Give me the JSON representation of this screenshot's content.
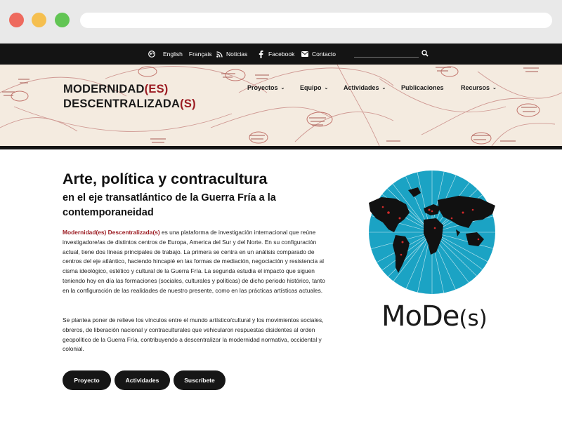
{
  "topbar": {
    "english": "English",
    "francais": "Français",
    "noticias": "Noticias",
    "facebook": "Facebook",
    "contacto": "Contacto",
    "icons": [
      "globe-icon",
      "rss-icon",
      "facebook-icon",
      "mail-icon",
      "search-icon"
    ]
  },
  "logo": {
    "line1_a": "MODERNIDAD",
    "line1_b": "(ES)",
    "line2_a": "DESCENTRALIZADA",
    "line2_b": "(S)",
    "accent_color": "#9b1b22"
  },
  "nav": {
    "items": [
      {
        "label": "Proyectos",
        "chev": "⌄"
      },
      {
        "label": "Equipo",
        "chev": "⌄"
      },
      {
        "label": "Actividades",
        "chev": "⌄"
      },
      {
        "label": "Publicaciones",
        "chev": ""
      },
      {
        "label": "Recursos",
        "chev": "⌄"
      }
    ]
  },
  "main": {
    "title": "Arte, política y contracultura",
    "subtitle": "en el eje transatlántico de la Guerra Fría a la contemporaneidad",
    "p1_lead": "Modernidad(es) Descentralizada(s)",
    "p1_rest": " es una plataforma de investigación internacional que reúne investigadore/as de distintos centros de Europa, America del Sur y del Norte. En su configuración actual, tiene dos líneas principales de trabajo. La primera se centra en un análisis comparado de centros del eje atlántico, haciendo hincapié en las formas de mediación, negociación y resistencia al cisma ideológico, estético y cultural de la Guerra Fría. La segunda estudia el impacto que siguen teniendo hoy en día las formaciones (sociales, culturales y políticas) de dicho periodo histórico, tanto en la configuración de las realidades de nuestro presente, como en las prácticas artísticas actuales.",
    "p2": "Se plantea poner de relieve los vínculos entre el mundo artístico/cultural y los movimientos sociales, obreros, de liberación nacional y contraculturales que vehicularon respuestas disidentes al orden geopolítico de la Guerra Fría, contribuyendo a descentralizar la modernidad normativa, occidental y colonial.",
    "buttons": [
      "Proyecto",
      "Actividades",
      "Suscríbete"
    ]
  },
  "brand": {
    "text_a": "MoDe",
    "text_b": "(s)",
    "globe_color": "#1ba3c4"
  }
}
